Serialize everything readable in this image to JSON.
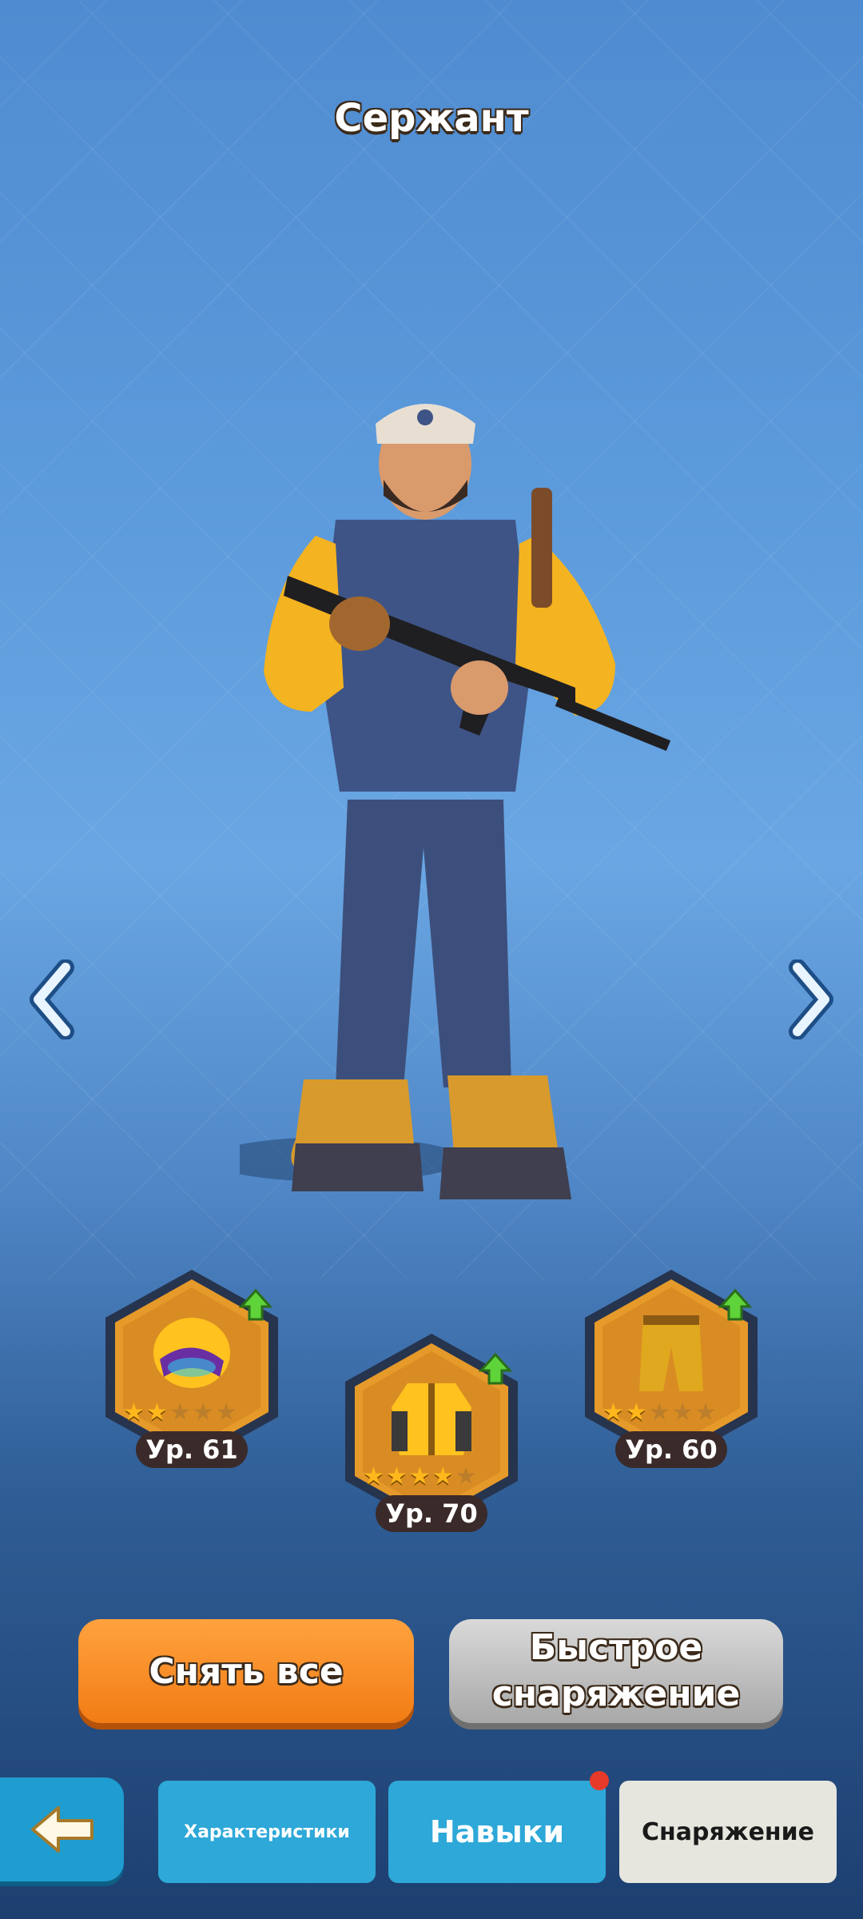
{
  "screen": {
    "title": "Сержант"
  },
  "nav": {
    "prev_icon": "chevron-left-icon",
    "next_icon": "chevron-right-icon"
  },
  "gear_slots": [
    {
      "name": "helmet",
      "icon": "helmet-icon",
      "level_label": "Ур. 61",
      "stars": 2,
      "max_stars": 5,
      "upgrade_available": true
    },
    {
      "name": "jacket",
      "icon": "jacket-icon",
      "level_label": "Ур. 70",
      "stars": 4,
      "max_stars": 5,
      "upgrade_available": true
    },
    {
      "name": "pants",
      "icon": "pants-icon",
      "level_label": "Ур. 60",
      "stars": 2,
      "max_stars": 5,
      "upgrade_available": true
    }
  ],
  "actions": {
    "unequip_all": "Снять все",
    "quick_equip_line1": "Быстрое",
    "quick_equip_line2": "снаряжение"
  },
  "tabs": {
    "stats": "Характеристики",
    "skills": "Навыки",
    "gear": "Снаряжение",
    "skills_notification": true,
    "active": "gear"
  },
  "colors": {
    "accent_orange": "#f27c14",
    "tab_blue": "#2da8d8",
    "star_gold": "#ffb81c",
    "notification_red": "#e63a2a"
  }
}
